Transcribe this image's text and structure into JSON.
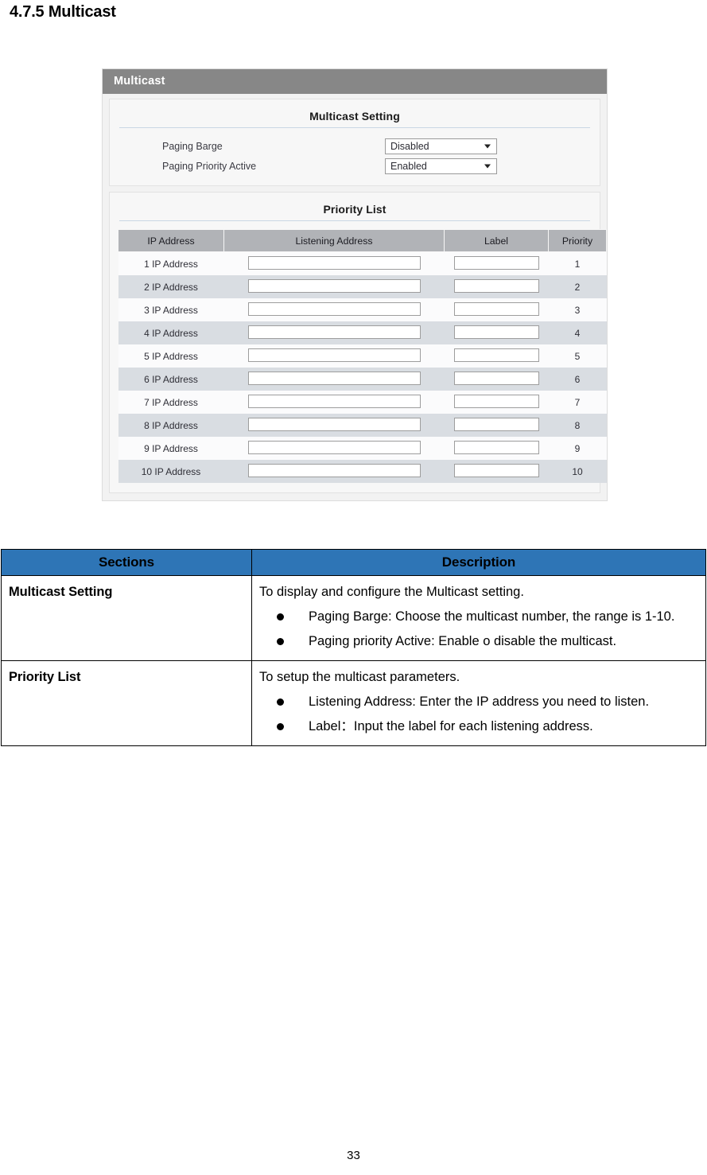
{
  "document": {
    "heading": "4.7.5 Multicast",
    "page_number": "33"
  },
  "screenshot": {
    "titlebar": "Multicast",
    "settings_card": {
      "title": "Multicast Setting",
      "rows": [
        {
          "label": "Paging Barge",
          "value": "Disabled"
        },
        {
          "label": "Paging Priority Active",
          "value": "Enabled"
        }
      ]
    },
    "priority_card": {
      "title": "Priority List",
      "columns": [
        "IP Address",
        "Listening Address",
        "Label",
        "Priority"
      ],
      "rows": [
        {
          "ip": "1 IP Address",
          "listening": "",
          "label": "",
          "priority": "1"
        },
        {
          "ip": "2 IP Address",
          "listening": "",
          "label": "",
          "priority": "2"
        },
        {
          "ip": "3 IP Address",
          "listening": "",
          "label": "",
          "priority": "3"
        },
        {
          "ip": "4 IP Address",
          "listening": "",
          "label": "",
          "priority": "4"
        },
        {
          "ip": "5 IP Address",
          "listening": "",
          "label": "",
          "priority": "5"
        },
        {
          "ip": "6 IP Address",
          "listening": "",
          "label": "",
          "priority": "6"
        },
        {
          "ip": "7 IP Address",
          "listening": "",
          "label": "",
          "priority": "7"
        },
        {
          "ip": "8 IP Address",
          "listening": "",
          "label": "",
          "priority": "8"
        },
        {
          "ip": "9 IP Address",
          "listening": "",
          "label": "",
          "priority": "9"
        },
        {
          "ip": "10 IP Address",
          "listening": "",
          "label": "",
          "priority": "10"
        }
      ]
    }
  },
  "description_table": {
    "headers": {
      "sections": "Sections",
      "description": "Description"
    },
    "rows": [
      {
        "section": "Multicast Setting",
        "lead": "To display and configure the Multicast setting.",
        "bullets": [
          "Paging Barge: Choose the multicast number, the range is 1-10.",
          "Paging priority Active: Enable o disable the multicast."
        ]
      },
      {
        "section": "Priority List",
        "lead": "To setup the multicast parameters.",
        "bullets": [
          "Listening Address: Enter the IP address you need to listen.",
          "Label：Input the label for each listening address."
        ]
      }
    ]
  },
  "colors": {
    "accent_blue": "#2E75B6",
    "titlebar_grey": "#878787",
    "table_header_grey": "#B1B3B7",
    "row_alt_grey": "#D9DDE2"
  }
}
